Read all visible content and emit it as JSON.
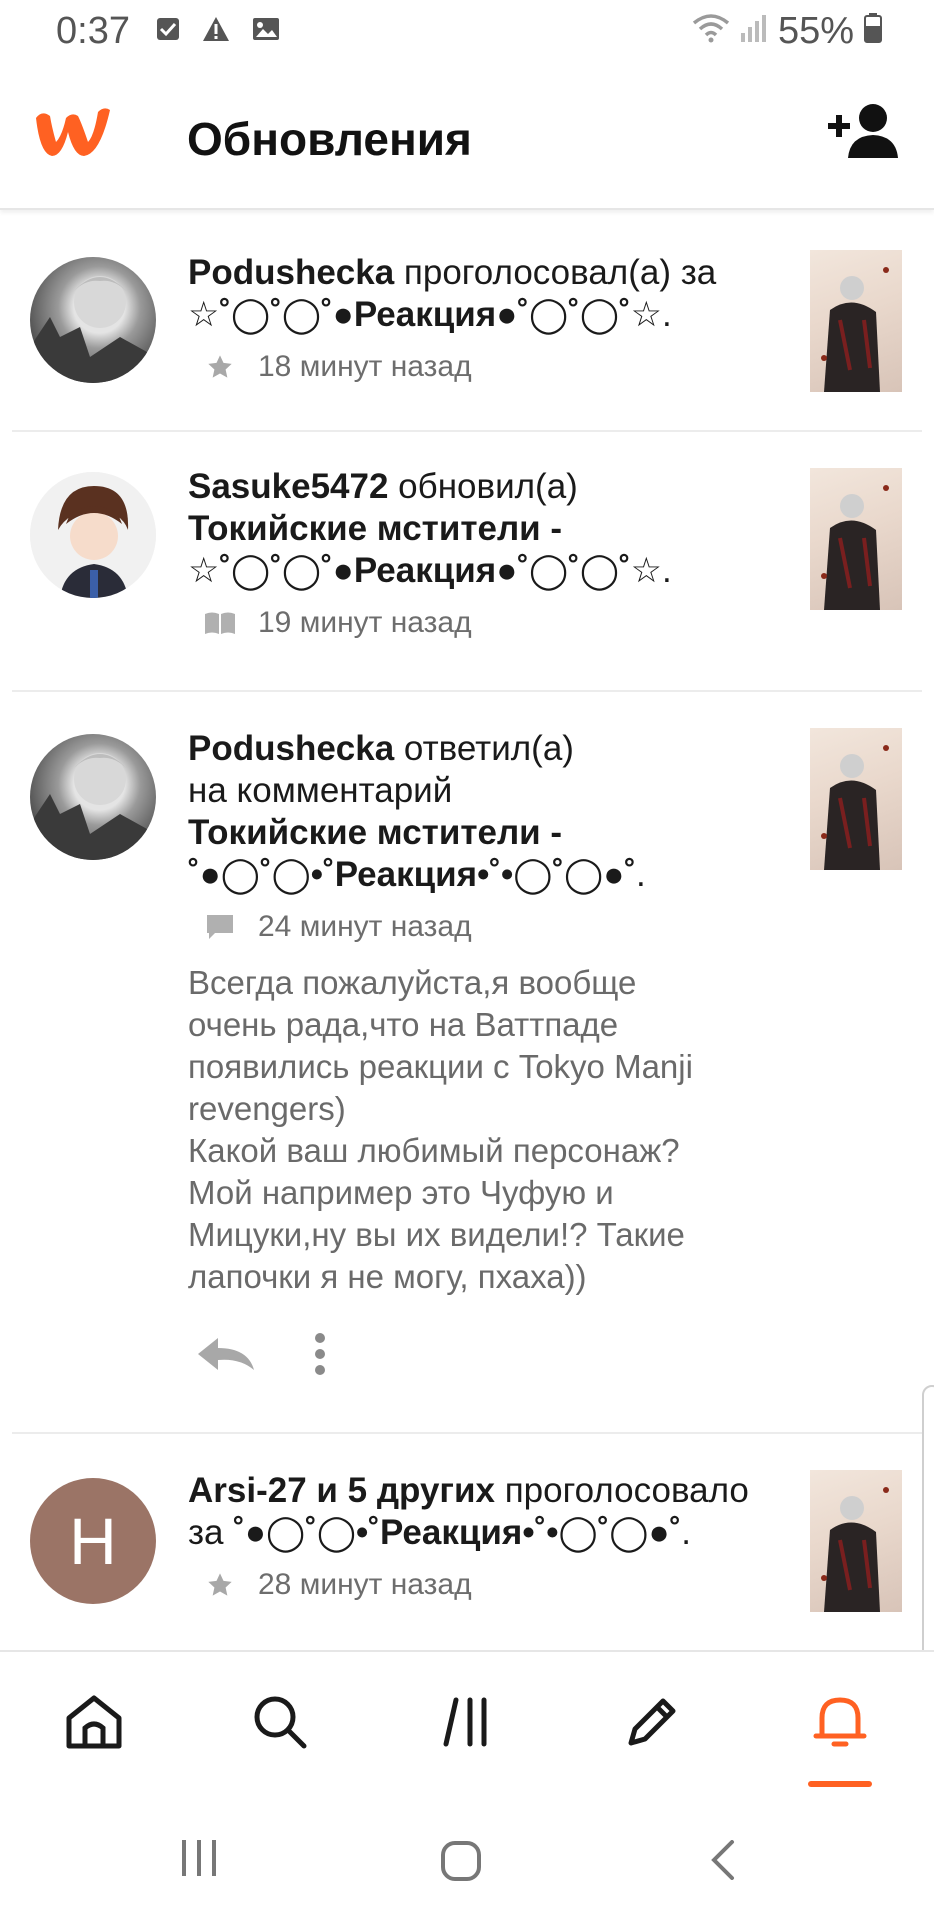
{
  "status_bar": {
    "time": "0:37",
    "battery": "55%",
    "icons": [
      "checkbox-icon",
      "warning-icon",
      "image-icon",
      "wifi-icon",
      "signal-icon",
      "battery-icon"
    ]
  },
  "header": {
    "title": "Обновления",
    "logo_color": "#ff6122",
    "action_icon": "add-user-icon"
  },
  "feed": [
    {
      "user": "Podushecka",
      "lines": [
        {
          "bold": "Podushecka",
          "text": " проголосовал(а) за"
        },
        {
          "bold": "☆˚◯˚◯˚●Реакция●˚◯˚◯˚☆",
          "text": "."
        }
      ],
      "meta_icon": "star-icon",
      "time": "18 минут назад"
    },
    {
      "user": "Sasuke5472",
      "lines": [
        {
          "bold": "Sasuke5472",
          "text": " обновил(а)"
        },
        {
          "bold": "Токийские мстители -",
          "text": ""
        },
        {
          "bold": "☆˚◯˚◯˚●Реакция●˚◯˚◯˚☆",
          "text": "."
        }
      ],
      "meta_icon": "book-icon",
      "time": "19 минут назад"
    },
    {
      "user": "Podushecka",
      "lines": [
        {
          "bold": "Podushecka",
          "text": " ответил(а)"
        },
        {
          "bold": "",
          "text": "на комментарий"
        },
        {
          "bold": "Токийские мстители -",
          "text": ""
        },
        {
          "bold": "˚●◯˚◯•˚Реакция•˚•◯˚◯●˚",
          "text": "."
        }
      ],
      "meta_icon": "comment-icon",
      "time": "24 минут назад",
      "comment": [
        "Всегда пожалуйста,я вообще",
        "очень рада,что на Ваттпаде",
        "появились реакции с Tokyo Manji",
        "revengers)",
        "Какой ваш любимый персонаж?",
        "Мой например это Чуфую и",
        "Мицуки,ну вы их видели!? Такие",
        "лапочки я не могу, пхаха))"
      ]
    },
    {
      "user": "Arsi-27",
      "avatar_letter": "H",
      "avatar_color": "#9b7466",
      "lines": [
        {
          "bold": "Arsi-27 и 5 других",
          "text": " проголосовало"
        },
        {
          "bold": "",
          "text": "за "
        },
        {
          "bold": "˚●◯˚◯•˚Реакция•˚•◯˚◯●˚",
          "text": "."
        }
      ],
      "meta_icon": "star-icon",
      "time": "28 минут назад"
    }
  ],
  "bottom_nav": {
    "items": [
      "home-icon",
      "search-icon",
      "library-icon",
      "write-icon",
      "notifications-icon"
    ],
    "active": "notifications-icon",
    "active_color": "#ff6122"
  }
}
